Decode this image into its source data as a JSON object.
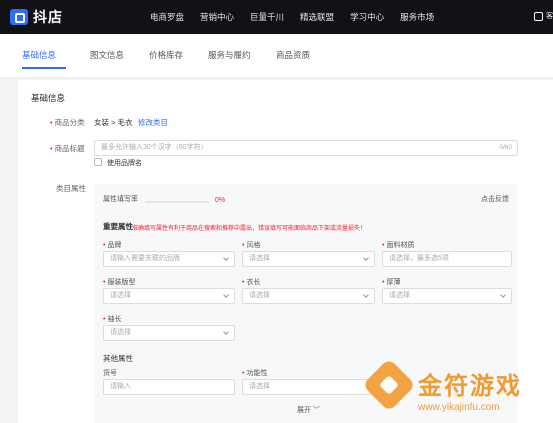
{
  "app": {
    "logo_text": "抖店"
  },
  "topnav": [
    "电商罗盘",
    "营销中心",
    "巨量千川",
    "精选联盟",
    "学习中心",
    "服务市场"
  ],
  "top_right": {
    "label": "客"
  },
  "tabs": [
    "基础信息",
    "图文信息",
    "价格库存",
    "服务与履约",
    "商品资质"
  ],
  "section": {
    "title": "基础信息"
  },
  "category": {
    "label": "商品分类",
    "value": "女装 > 毛衣",
    "link": "修改类目"
  },
  "product_title": {
    "label": "商品标题",
    "placeholder": "最多允许输入30个汉字（60字符）",
    "counter": "0/60",
    "brand_checkbox": "使用品牌名"
  },
  "attrs": {
    "label": "类目属性",
    "fill_rate_label": "属性填写率",
    "fill_rate_percent": "0%",
    "fill_rate": 0,
    "feedback": "点击反馈",
    "important_title": "重要属性",
    "important_hint": "准确填写属性有利于商品在搜索和推荐中露出，错误填写可能面临商品下架或流量损失！",
    "fields": [
      {
        "label": "品牌",
        "placeholder": "请输入需要关联的品牌",
        "required": true
      },
      {
        "label": "风格",
        "placeholder": "请选择",
        "required": true
      },
      {
        "label": "面料材质",
        "placeholder": "请选择，最多选5项",
        "required": true
      },
      {
        "label": "服装版型",
        "placeholder": "请选择",
        "required": true
      },
      {
        "label": "衣长",
        "placeholder": "请选择",
        "required": true
      },
      {
        "label": "厚薄",
        "placeholder": "请选择",
        "required": true
      },
      {
        "label": "袖长",
        "placeholder": "请选择",
        "required": true
      }
    ],
    "other_title": "其他属性",
    "other_fields": [
      {
        "label": "货号",
        "placeholder": "请输入",
        "required": false
      },
      {
        "label": "功能性",
        "placeholder": "请选择",
        "required": true
      }
    ],
    "expand": "展开"
  },
  "watermark": {
    "title": "金符游戏",
    "url": "www.yikajinfu.com"
  },
  "colors": {
    "accent": "#2f6bff",
    "required": "#f5222d",
    "topbar": "#101216",
    "watermark": "#f29a2e"
  }
}
